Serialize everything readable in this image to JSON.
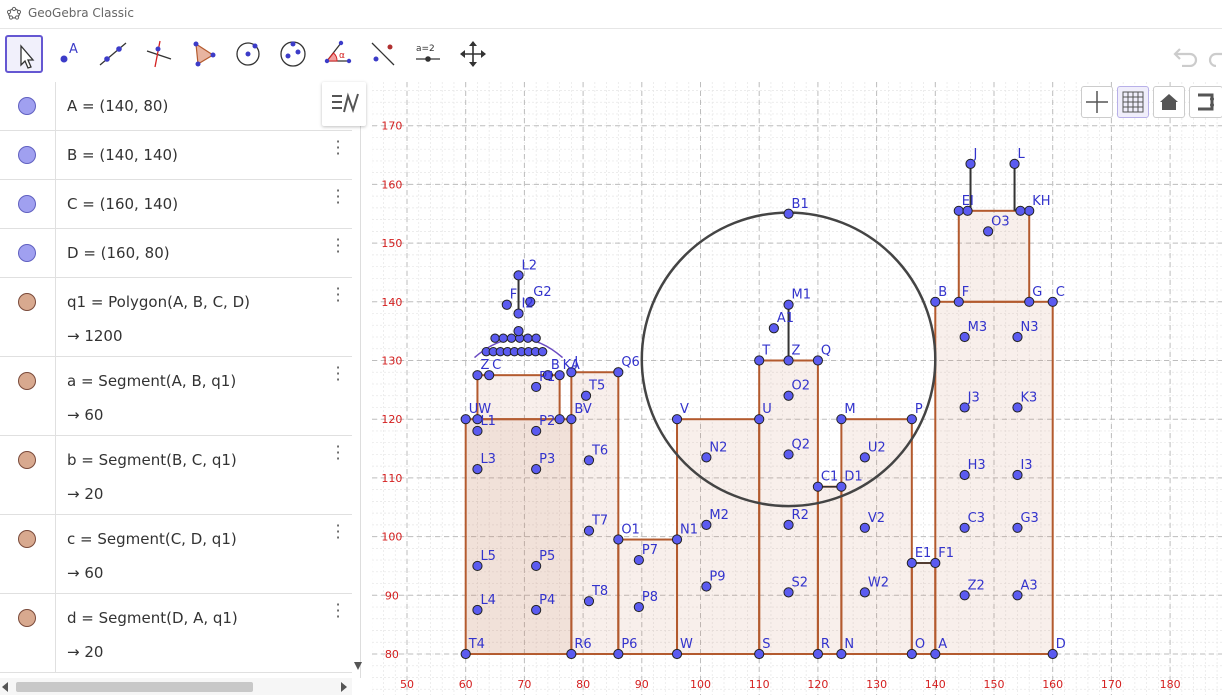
{
  "app": {
    "title": "GeoGebra Classic"
  },
  "toolbar": {
    "tools": [
      {
        "name": "move-tool",
        "icon": "arrow-icon"
      },
      {
        "name": "point-tool",
        "icon": "point-icon",
        "label": "A"
      },
      {
        "name": "line-tool",
        "icon": "line-icon"
      },
      {
        "name": "perpendicular-tool",
        "icon": "perpendicular-icon"
      },
      {
        "name": "polygon-tool",
        "icon": "polygon-icon"
      },
      {
        "name": "circle-tool",
        "icon": "circle-icon"
      },
      {
        "name": "ellipse-tool",
        "icon": "ellipse-icon"
      },
      {
        "name": "angle-tool",
        "icon": "angle-icon",
        "label": "α"
      },
      {
        "name": "reflect-tool",
        "icon": "reflect-icon"
      },
      {
        "name": "slider-tool",
        "icon": "slider-icon",
        "label": "a=2"
      },
      {
        "name": "move-graphics-tool",
        "icon": "move-graphics-icon"
      }
    ]
  },
  "algebra": {
    "rows": [
      {
        "def": "A = (140, 80)",
        "color": "#a0a0f0",
        "type": "point"
      },
      {
        "def": "B = (140, 140)",
        "color": "#a0a0f0",
        "type": "point"
      },
      {
        "def": "C = (160, 140)",
        "color": "#a0a0f0",
        "type": "point"
      },
      {
        "def": "D = (160, 80)",
        "color": "#a0a0f0",
        "type": "point"
      },
      {
        "def": "q1 = Polygon(A, B, C, D)",
        "value": "→ 1200",
        "color": "#d8a98f",
        "type": "poly"
      },
      {
        "def": "a = Segment(A, B, q1)",
        "value": "→ 60",
        "color": "#d8a98f",
        "type": "poly"
      },
      {
        "def": "b = Segment(B, C, q1)",
        "value": "→ 20",
        "color": "#d8a98f",
        "type": "poly"
      },
      {
        "def": "c = Segment(C, D, q1)",
        "value": "→ 60",
        "color": "#d8a98f",
        "type": "poly"
      },
      {
        "def": "d = Segment(D, A, q1)",
        "value": "→ 20",
        "color": "#d8a98f",
        "type": "poly"
      }
    ]
  },
  "axes": {
    "x_ticks": [
      "50",
      "60",
      "70",
      "80",
      "90",
      "100",
      "110",
      "120",
      "130",
      "140",
      "150",
      "160",
      "170",
      "180"
    ],
    "y_ticks": [
      "80",
      "90",
      "100",
      "110",
      "120",
      "130",
      "140",
      "150",
      "160",
      "170"
    ]
  },
  "colors": {
    "point": "#5b5bf0",
    "polygon_stroke": "#b35a2e",
    "polygon_fill": "#c97a5a",
    "axis_label": "#d42020",
    "grid": "#c8c8c8",
    "label_blue": "#3333cc",
    "label_brown": "#a0522d"
  },
  "figure": {
    "rects": [
      {
        "x1": 60,
        "y1": 80,
        "x2": 78,
        "y2": 120
      },
      {
        "x1": 62,
        "y1": 120,
        "x2": 76,
        "y2": 127.5
      },
      {
        "x1": 78,
        "y1": 80,
        "x2": 86,
        "y2": 128
      },
      {
        "x1": 86,
        "y1": 80,
        "x2": 96,
        "y2": 99.5
      },
      {
        "x1": 96,
        "y1": 80,
        "x2": 110,
        "y2": 120
      },
      {
        "x1": 110,
        "y1": 80,
        "x2": 120,
        "y2": 130
      },
      {
        "x1": 120,
        "y1": 80,
        "x2": 124,
        "y2": 108.5
      },
      {
        "x1": 124,
        "y1": 80,
        "x2": 136,
        "y2": 120
      },
      {
        "x1": 136,
        "y1": 80,
        "x2": 140,
        "y2": 95.5
      },
      {
        "x1": 140,
        "y1": 80,
        "x2": 160,
        "y2": 140
      },
      {
        "x1": 144,
        "y1": 140,
        "x2": 156,
        "y2": 155.5
      }
    ],
    "circle": {
      "cx": 115,
      "cy": 130.2,
      "r": 25
    },
    "points": [
      {
        "x": 60,
        "y": 80,
        "label": "T4"
      },
      {
        "x": 78,
        "y": 80,
        "label": "R6"
      },
      {
        "x": 86,
        "y": 80,
        "label": "P6"
      },
      {
        "x": 96,
        "y": 80,
        "label": "W"
      },
      {
        "x": 110,
        "y": 80,
        "label": "S"
      },
      {
        "x": 120,
        "y": 80,
        "label": "R"
      },
      {
        "x": 124,
        "y": 80,
        "label": "N"
      },
      {
        "x": 136,
        "y": 80,
        "label": "O"
      },
      {
        "x": 140,
        "y": 80,
        "label": "A"
      },
      {
        "x": 160,
        "y": 80,
        "label": "D"
      },
      {
        "x": 140,
        "y": 140,
        "label": "B"
      },
      {
        "x": 160,
        "y": 140,
        "label": "C"
      },
      {
        "x": 144,
        "y": 140,
        "label": "F"
      },
      {
        "x": 156,
        "y": 140,
        "label": "G"
      },
      {
        "x": 144,
        "y": 155.5,
        "label": "EI"
      },
      {
        "x": 156,
        "y": 155.5,
        "label": "KH"
      },
      {
        "x": 145.5,
        "y": 155.5,
        "label": ""
      },
      {
        "x": 154.5,
        "y": 155.5,
        "label": ""
      },
      {
        "x": 146,
        "y": 163.5,
        "label": "J"
      },
      {
        "x": 153.5,
        "y": 163.5,
        "label": "L"
      },
      {
        "x": 149,
        "y": 152,
        "label": "O3"
      },
      {
        "x": 145,
        "y": 134,
        "label": "M3"
      },
      {
        "x": 154,
        "y": 134,
        "label": "N3"
      },
      {
        "x": 145,
        "y": 122,
        "label": "J3"
      },
      {
        "x": 154,
        "y": 122,
        "label": "K3"
      },
      {
        "x": 145,
        "y": 110.5,
        "label": "H3"
      },
      {
        "x": 154,
        "y": 110.5,
        "label": "I3"
      },
      {
        "x": 145,
        "y": 101.5,
        "label": "C3"
      },
      {
        "x": 154,
        "y": 101.5,
        "label": "G3"
      },
      {
        "x": 145,
        "y": 90,
        "label": "Z2"
      },
      {
        "x": 154,
        "y": 90,
        "label": "A3"
      },
      {
        "x": 136,
        "y": 95.5,
        "label": "E1"
      },
      {
        "x": 140,
        "y": 95.5,
        "label": "F1"
      },
      {
        "x": 124,
        "y": 120,
        "label": "M"
      },
      {
        "x": 136,
        "y": 120,
        "label": "P"
      },
      {
        "x": 128,
        "y": 113.5,
        "label": "U2"
      },
      {
        "x": 128,
        "y": 101.5,
        "label": "V2"
      },
      {
        "x": 128,
        "y": 90.5,
        "label": "W2"
      },
      {
        "x": 120,
        "y": 108.5,
        "label": "C1"
      },
      {
        "x": 124,
        "y": 108.5,
        "label": "D1"
      },
      {
        "x": 110,
        "y": 130,
        "label": "T"
      },
      {
        "x": 115,
        "y": 130,
        "label": "Z"
      },
      {
        "x": 120,
        "y": 130,
        "label": "Q"
      },
      {
        "x": 115,
        "y": 139.5,
        "label": "M1"
      },
      {
        "x": 112.5,
        "y": 135.5,
        "label": "A1"
      },
      {
        "x": 115,
        "y": 155,
        "label": "B1"
      },
      {
        "x": 115,
        "y": 124,
        "label": "O2"
      },
      {
        "x": 115,
        "y": 114,
        "label": "Q2"
      },
      {
        "x": 115,
        "y": 102,
        "label": "R2"
      },
      {
        "x": 115,
        "y": 90.5,
        "label": "S2"
      },
      {
        "x": 110,
        "y": 120,
        "label": "U"
      },
      {
        "x": 96,
        "y": 120,
        "label": "V"
      },
      {
        "x": 96,
        "y": 99.5,
        "label": "N1"
      },
      {
        "x": 86,
        "y": 99.5,
        "label": "O1"
      },
      {
        "x": 101,
        "y": 113.5,
        "label": "N2"
      },
      {
        "x": 101,
        "y": 102,
        "label": "M2"
      },
      {
        "x": 101,
        "y": 91.5,
        "label": "P9"
      },
      {
        "x": 89.5,
        "y": 96,
        "label": "P7"
      },
      {
        "x": 89.5,
        "y": 88,
        "label": "P8"
      },
      {
        "x": 86,
        "y": 128,
        "label": "Q6"
      },
      {
        "x": 78,
        "y": 128,
        "label": "J"
      },
      {
        "x": 80.5,
        "y": 124,
        "label": "T5"
      },
      {
        "x": 81,
        "y": 113,
        "label": "T6"
      },
      {
        "x": 81,
        "y": 101,
        "label": "T7"
      },
      {
        "x": 81,
        "y": 89,
        "label": "T8"
      },
      {
        "x": 60,
        "y": 120,
        "label": "UW"
      },
      {
        "x": 78,
        "y": 120,
        "label": "BV"
      },
      {
        "x": 76,
        "y": 120,
        "label": ""
      },
      {
        "x": 62,
        "y": 120,
        "label": ""
      },
      {
        "x": 62,
        "y": 127.5,
        "label": "Z"
      },
      {
        "x": 76,
        "y": 127.5,
        "label": "KA"
      },
      {
        "x": 64,
        "y": 127.5,
        "label": "C"
      },
      {
        "x": 74,
        "y": 127.5,
        "label": "B"
      },
      {
        "x": 62,
        "y": 118,
        "label": "L1"
      },
      {
        "x": 62,
        "y": 111.5,
        "label": "L3"
      },
      {
        "x": 62,
        "y": 95,
        "label": "L5"
      },
      {
        "x": 62,
        "y": 87.5,
        "label": "L4"
      },
      {
        "x": 72,
        "y": 118,
        "label": "P2"
      },
      {
        "x": 72,
        "y": 111.5,
        "label": "P3"
      },
      {
        "x": 72,
        "y": 95,
        "label": "P5"
      },
      {
        "x": 72,
        "y": 87.5,
        "label": "P4"
      },
      {
        "x": 72,
        "y": 125.5,
        "label": "P1"
      },
      {
        "x": 69,
        "y": 135,
        "label": ""
      },
      {
        "x": 69,
        "y": 138,
        "label": "I2"
      },
      {
        "x": 69,
        "y": 144.5,
        "label": "L2"
      },
      {
        "x": 71,
        "y": 140,
        "label": "G2"
      },
      {
        "x": 67,
        "y": 139.5,
        "label": "F"
      }
    ]
  }
}
